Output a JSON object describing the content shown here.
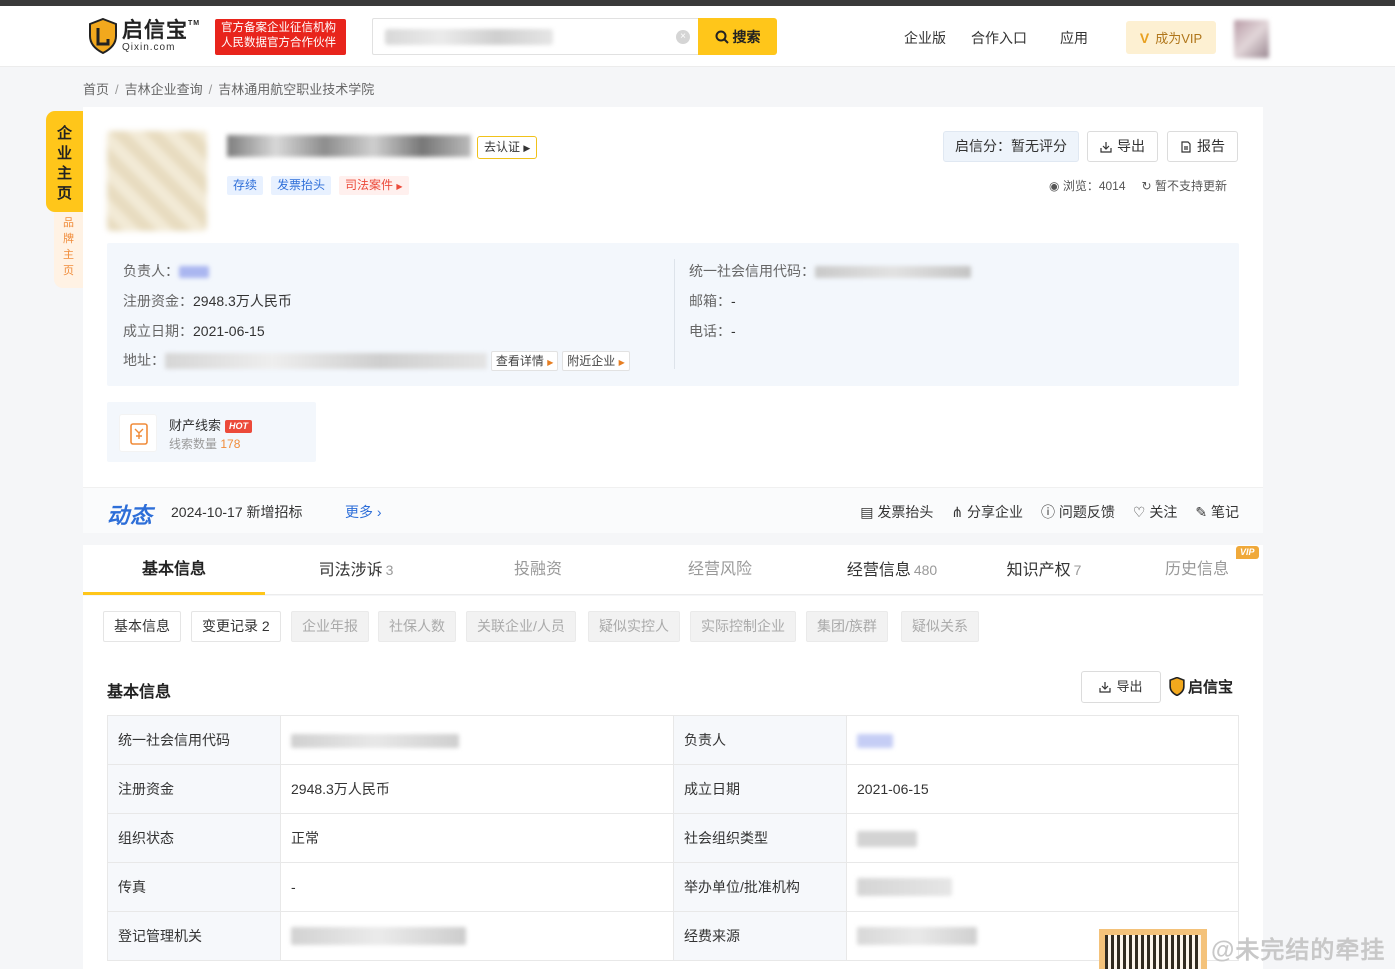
{
  "header": {
    "logo_cn": "启信宝",
    "logo_en": "Qixin.com",
    "badge_line1": "官方备案企业征信机构",
    "badge_line2": "人民数据官方合作伙伴",
    "search_button": "搜索",
    "nav": [
      "企业版",
      "合作入口",
      "应用"
    ],
    "vip_label": "成为VIP"
  },
  "breadcrumb": [
    "首页",
    "吉林企业查询",
    "吉林通用航空职业技术学院"
  ],
  "side": {
    "main_tab": [
      "企",
      "业",
      "主",
      "页"
    ],
    "brand_tab": [
      "品",
      "牌",
      "主",
      "页"
    ]
  },
  "company": {
    "cert_label": "去认证",
    "tags": [
      "存续",
      "发票抬头",
      "司法案件"
    ],
    "rating": "启信分：暂无评分",
    "export_label": "导出",
    "report_label": "报告",
    "views_label": "浏览：4014",
    "update_label": "暂不支持更新",
    "info": {
      "person_key": "负责人：",
      "capital_key": "注册资金：",
      "capital_val": "2948.3万人民币",
      "date_key": "成立日期：",
      "date_val": "2021-06-15",
      "addr_key": "地址：",
      "addr_detail_btn": "查看详情",
      "nearby_btn": "附近企业",
      "credit_key": "统一社会信用代码：",
      "email_key": "邮箱：",
      "email_val": "-",
      "phone_key": "电话：",
      "phone_val": "-"
    },
    "clue": {
      "title": "财产线索",
      "hot": "HOT",
      "count_label": "线索数量",
      "count": "178"
    }
  },
  "dynamic": {
    "title": "动态",
    "text": "2024-10-17 新增招标",
    "more": "更多",
    "actions": [
      "发票抬头",
      "分享企业",
      "问题反馈",
      "关注",
      "笔记"
    ]
  },
  "tabs": [
    {
      "label": "基本信息",
      "count": ""
    },
    {
      "label": "司法涉诉",
      "count": "3"
    },
    {
      "label": "投融资",
      "count": ""
    },
    {
      "label": "经营风险",
      "count": ""
    },
    {
      "label": "经营信息",
      "count": "480"
    },
    {
      "label": "知识产权",
      "count": "7"
    },
    {
      "label": "历史信息",
      "count": ""
    }
  ],
  "vip_badge": "VIP",
  "subtabs": [
    "基本信息",
    "变更记录 2",
    "企业年报",
    "社保人数",
    "关联企业/人员",
    "疑似实控人",
    "实际控制企业",
    "集团/族群",
    "疑似关系"
  ],
  "basic": {
    "title": "基本信息",
    "export": "导出",
    "logo": "启信宝",
    "rows": [
      {
        "k1": "统一社会信用代码",
        "v1": "",
        "k2": "负责人",
        "v2": ""
      },
      {
        "k1": "注册资金",
        "v1": "2948.3万人民币",
        "k2": "成立日期",
        "v2": "2021-06-15"
      },
      {
        "k1": "组织状态",
        "v1": "正常",
        "k2": "社会组织类型",
        "v2": ""
      },
      {
        "k1": "传真",
        "v1": "-",
        "k2": "举办单位/批准机构",
        "v2": ""
      },
      {
        "k1": "登记管理机关",
        "v1": "",
        "k2": "经费来源",
        "v2": ""
      }
    ]
  },
  "watermark": "@未完结的牵挂"
}
